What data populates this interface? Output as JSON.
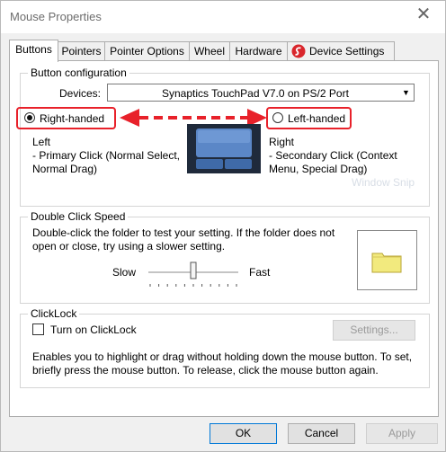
{
  "window": {
    "title": "Mouse Properties",
    "close_glyph": "✕"
  },
  "tabs": [
    {
      "label": "Buttons"
    },
    {
      "label": "Pointers"
    },
    {
      "label": "Pointer Options"
    },
    {
      "label": "Wheel"
    },
    {
      "label": "Hardware"
    },
    {
      "label": "Device Settings"
    }
  ],
  "button_config": {
    "title": "Button configuration",
    "devices_label": "Devices:",
    "device_value": "Synaptics TouchPad V7.0 on PS/2 Port",
    "right_handed_label": "Right-handed",
    "left_handed_label": "Left-handed",
    "right_handed_selected": true,
    "left_title": "Left",
    "left_line1": " - Primary Click (Normal Select,",
    "left_line2": "Normal Drag)",
    "right_title": "Right",
    "right_line1": " - Secondary Click (Context",
    "right_line2": "Menu, Special Drag)"
  },
  "double_click": {
    "title": "Double Click Speed",
    "desc_line1": "Double-click the folder to test your setting.  If the folder does not",
    "desc_line2": "open or close, try using a slower setting.",
    "slow_label": "Slow",
    "fast_label": "Fast",
    "speed_value": 0.5
  },
  "clicklock": {
    "title": "ClickLock",
    "checkbox_label": "Turn on ClickLock",
    "checked": false,
    "settings_label": "Settings...",
    "desc_line1": "Enables you to highlight or drag without holding down the mouse button.  To set,",
    "desc_line2": "briefly press the mouse button.  To release, click the mouse button again."
  },
  "footer": {
    "ok_label": "OK",
    "cancel_label": "Cancel",
    "apply_label": "Apply"
  },
  "overlay": {
    "ghost_text": "Window Snip"
  },
  "colors": {
    "annotation": "#e8212a",
    "folder": "#f2ea7e",
    "touchpad_dark": "#1f2a3b",
    "touchpad_light": "#5b87c7"
  },
  "icons": {
    "device_settings": "synaptics-logo-icon",
    "folder": "folder-icon",
    "close": "close-icon"
  }
}
